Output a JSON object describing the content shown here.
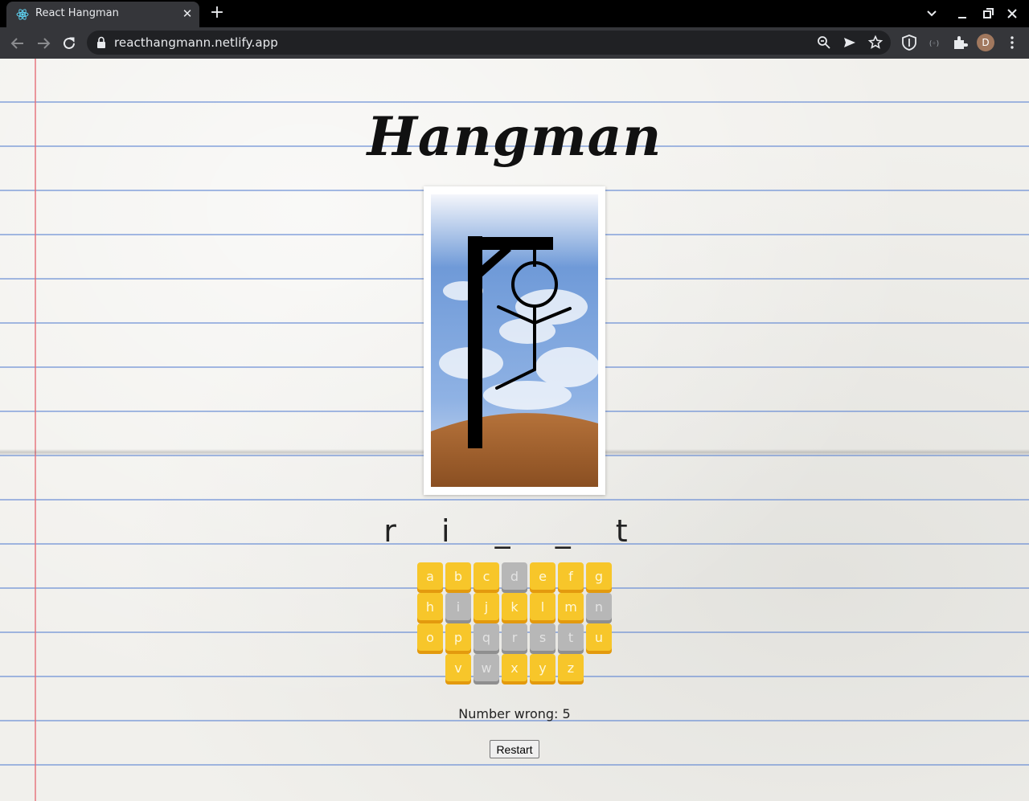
{
  "browser": {
    "tab_title": "React Hangman",
    "url": "reacthangmann.netlify.app",
    "profile_initial": "D"
  },
  "page": {
    "title": "Hangman",
    "word_display": "r i _ _ t",
    "wrong_label": "Number wrong: 5",
    "restart_label": "Restart"
  },
  "keyboard": {
    "rows": [
      [
        {
          "letter": "a",
          "enabled": true
        },
        {
          "letter": "b",
          "enabled": true
        },
        {
          "letter": "c",
          "enabled": true
        },
        {
          "letter": "d",
          "enabled": false
        },
        {
          "letter": "e",
          "enabled": true
        },
        {
          "letter": "f",
          "enabled": true
        },
        {
          "letter": "g",
          "enabled": true
        }
      ],
      [
        {
          "letter": "h",
          "enabled": true
        },
        {
          "letter": "i",
          "enabled": false
        },
        {
          "letter": "j",
          "enabled": true
        },
        {
          "letter": "k",
          "enabled": true
        },
        {
          "letter": "l",
          "enabled": true
        },
        {
          "letter": "m",
          "enabled": true
        },
        {
          "letter": "n",
          "enabled": false
        }
      ],
      [
        {
          "letter": "o",
          "enabled": true
        },
        {
          "letter": "p",
          "enabled": true
        },
        {
          "letter": "q",
          "enabled": false
        },
        {
          "letter": "r",
          "enabled": false
        },
        {
          "letter": "s",
          "enabled": false
        },
        {
          "letter": "t",
          "enabled": false
        },
        {
          "letter": "u",
          "enabled": true
        }
      ],
      [
        {
          "letter": "v",
          "enabled": true
        },
        {
          "letter": "w",
          "enabled": false
        },
        {
          "letter": "x",
          "enabled": true
        },
        {
          "letter": "y",
          "enabled": true
        },
        {
          "letter": "z",
          "enabled": true
        }
      ]
    ]
  },
  "colors": {
    "key_enabled": "#f7c62a",
    "key_disabled": "#b7b7b7",
    "browser_dark": "#35363a"
  }
}
